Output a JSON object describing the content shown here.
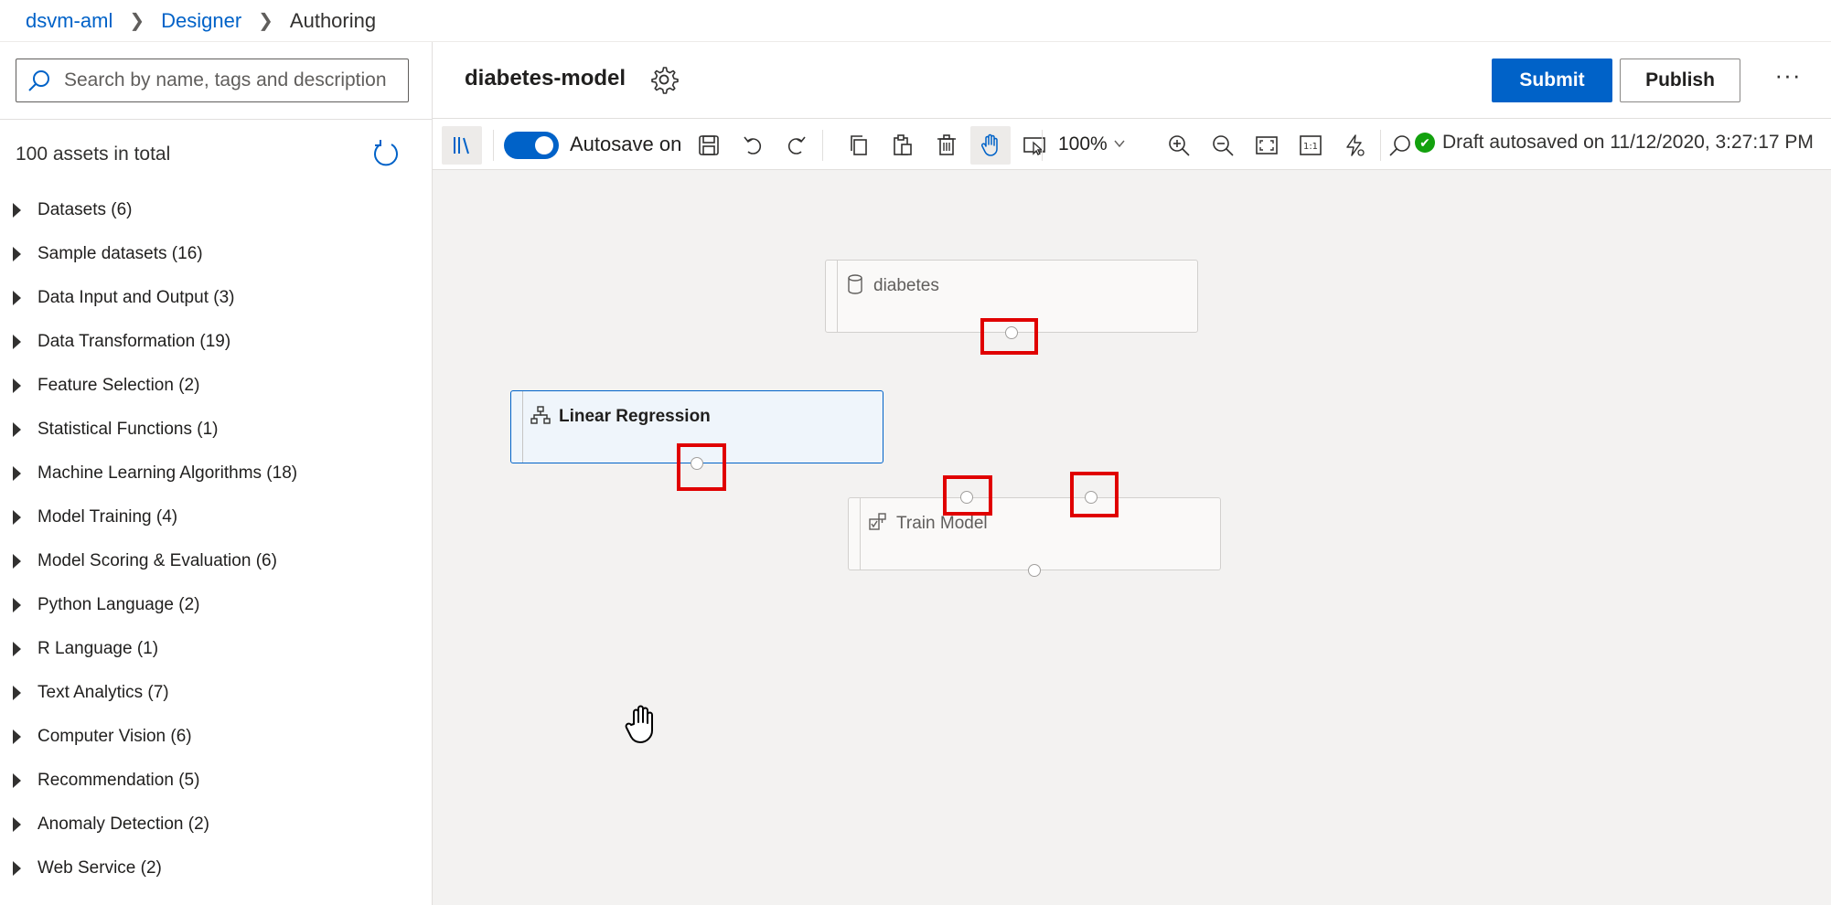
{
  "breadcrumb": {
    "workspace": "dsvm-aml",
    "section": "Designer",
    "current": "Authoring"
  },
  "left_panel": {
    "search_placeholder": "Search by name, tags and description",
    "assets_total": "100 assets in total",
    "categories": [
      {
        "label": "Datasets (6)"
      },
      {
        "label": "Sample datasets (16)"
      },
      {
        "label": "Data Input and Output (3)"
      },
      {
        "label": "Data Transformation (19)"
      },
      {
        "label": "Feature Selection (2)"
      },
      {
        "label": "Statistical Functions (1)"
      },
      {
        "label": "Machine Learning Algorithms (18)"
      },
      {
        "label": "Model Training (4)"
      },
      {
        "label": "Model Scoring & Evaluation (6)"
      },
      {
        "label": "Python Language (2)"
      },
      {
        "label": "R Language (1)"
      },
      {
        "label": "Text Analytics (7)"
      },
      {
        "label": "Computer Vision (6)"
      },
      {
        "label": "Recommendation (5)"
      },
      {
        "label": "Anomaly Detection (2)"
      },
      {
        "label": "Web Service (2)"
      }
    ]
  },
  "header": {
    "pipeline_title": "diabetes-model",
    "submit_label": "Submit",
    "publish_label": "Publish",
    "more_label": "···"
  },
  "toolbar": {
    "autosave_label": "Autosave on",
    "autosave_on": true,
    "zoom": "100%",
    "status": "Draft autosaved on 11/12/2020, 3:27:17 PM"
  },
  "canvas": {
    "nodes": {
      "diabetes": {
        "label": "diabetes",
        "icon": "dataset-icon"
      },
      "linear_regression": {
        "label": "Linear Regression",
        "icon": "algorithm-icon",
        "selected": true
      },
      "train_model": {
        "label": "Train Model",
        "icon": "train-module-icon"
      }
    }
  },
  "colors": {
    "accent": "#0062c8",
    "highlight": "#e00000",
    "success": "#13a10e",
    "canvas_bg": "#f3f2f1"
  }
}
